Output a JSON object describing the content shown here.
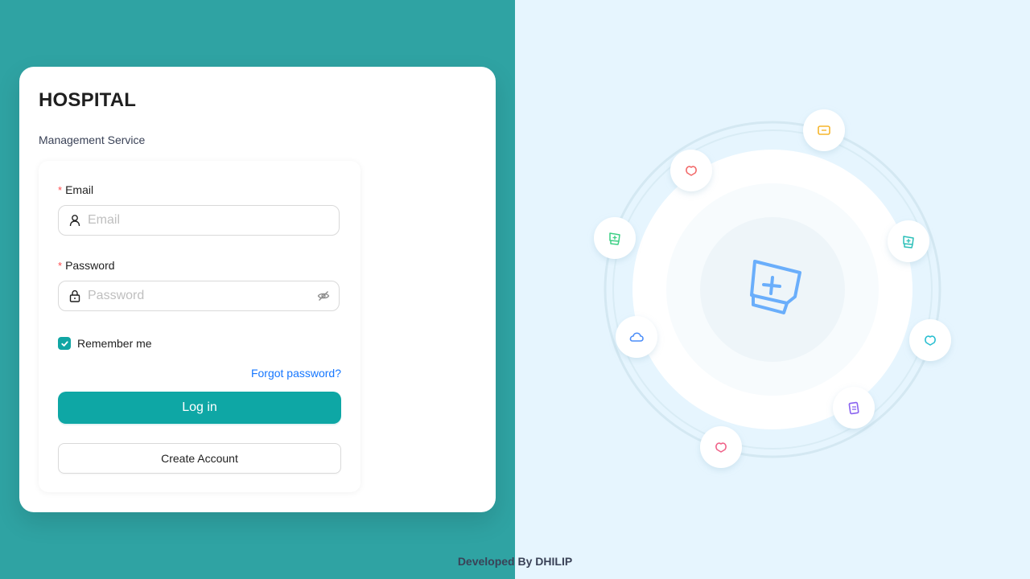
{
  "brand": {
    "title": "HOSPITAL",
    "subtitle": "Management Service"
  },
  "form": {
    "email": {
      "label": "Email",
      "required_mark": "*",
      "placeholder": "Email",
      "value": ""
    },
    "password": {
      "label": "Password",
      "required_mark": "*",
      "placeholder": "Password",
      "value": ""
    },
    "remember_label": "Remember me",
    "remember_checked": true,
    "forgot_label": "Forgot password?",
    "login_label": "Log in",
    "create_label": "Create Account"
  },
  "footer": {
    "text": "Developed By DHILIP"
  },
  "illustration": {
    "center_icon": "medical-kit-icon",
    "orbit_icons": [
      {
        "name": "ticket-icon",
        "color": "#f5b52c"
      },
      {
        "name": "heart-icon",
        "color": "#f26b6b"
      },
      {
        "name": "medicine-box-icon",
        "color": "#3ccf84"
      },
      {
        "name": "medicine-box-icon",
        "color": "#2bbfb8"
      },
      {
        "name": "cloud-icon",
        "color": "#4b8df8"
      },
      {
        "name": "heart-icon",
        "color": "#2bbfd1"
      },
      {
        "name": "report-icon",
        "color": "#8a63f0"
      },
      {
        "name": "heart-icon",
        "color": "#f0648a"
      }
    ]
  },
  "colors": {
    "left_bg": "#2fa3a3",
    "right_bg": "#e6f5fe",
    "primary": "#0ea7a5",
    "link": "#1677ff",
    "required": "#ff4d4f"
  }
}
